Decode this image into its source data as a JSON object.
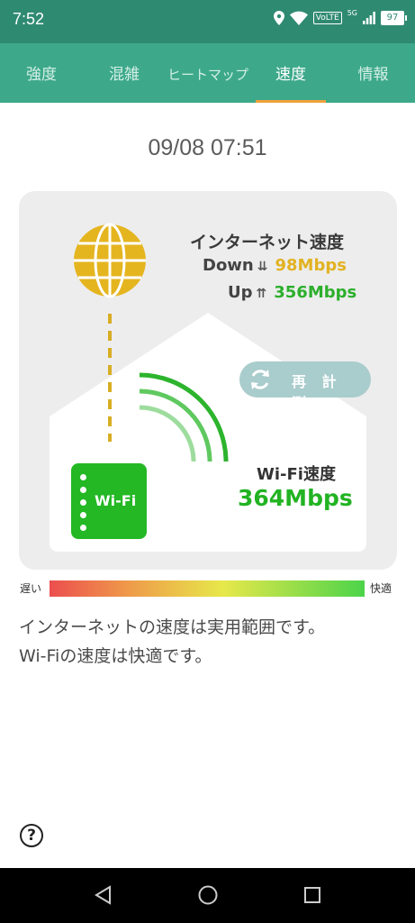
{
  "status_bar": {
    "time": "7:52",
    "icons": [
      "location-icon",
      "wifi-icon",
      "volte-badge",
      "signal-5g-icon",
      "battery-icon"
    ],
    "volte_label": "VoLTE",
    "network_label": "5G",
    "battery_level": "97"
  },
  "tabs": [
    {
      "label": "強度",
      "active": false
    },
    {
      "label": "混雑",
      "active": false
    },
    {
      "label": "ヒートマップ",
      "active": false
    },
    {
      "label": "速度",
      "active": true
    },
    {
      "label": "情報",
      "active": false
    }
  ],
  "timestamp": "09/08 07:51",
  "internet": {
    "title": "インターネット速度",
    "down_label": "Down",
    "down_value": "98Mbps",
    "up_label": "Up",
    "up_value": "356Mbps"
  },
  "retest_label": "再 計 測",
  "wifi": {
    "title": "Wi-Fi速度",
    "value": "364Mbps",
    "router_label": "Wi-Fi"
  },
  "scale": {
    "slow_label": "遅い",
    "fast_label": "快適"
  },
  "message": {
    "line1": "インターネットの速度は実用範囲です。",
    "line2": "Wi-Fiの速度は快適です。"
  },
  "colors": {
    "header": "#3da98a",
    "status_bar": "#2f8a72",
    "tab_indicator": "#f0a23b",
    "down_color": "#e2b221",
    "up_color": "#2caf2c",
    "wifi_green": "#23b824",
    "retest_button": "#a9cccc"
  }
}
